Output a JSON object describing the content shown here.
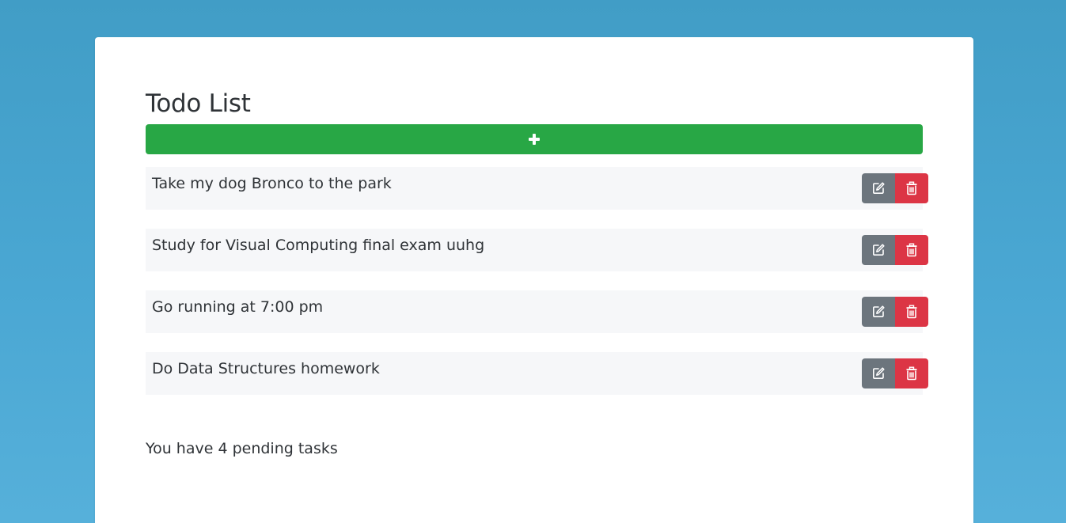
{
  "app": {
    "title": "Todo List",
    "add_button_icon": "plus-icon"
  },
  "todos": [
    {
      "text": "Take my dog Bronco to the park",
      "edit_icon": "edit-icon",
      "delete_icon": "trash-icon"
    },
    {
      "text": "Study for Visual Computing final exam uuhg",
      "edit_icon": "edit-icon",
      "delete_icon": "trash-icon"
    },
    {
      "text": "Go running at 7:00 pm",
      "edit_icon": "edit-icon",
      "delete_icon": "trash-icon"
    },
    {
      "text": "Do Data Structures homework",
      "edit_icon": "edit-icon",
      "delete_icon": "trash-icon"
    }
  ],
  "footer": {
    "pending_text": "You have 4 pending tasks"
  },
  "colors": {
    "background_top": "#419dc6",
    "background_bottom": "#56b0da",
    "add_button": "#28a745",
    "edit_button": "#6c757d",
    "delete_button": "#dc3545",
    "item_background": "#f6f7f9",
    "text": "#2f3337"
  }
}
